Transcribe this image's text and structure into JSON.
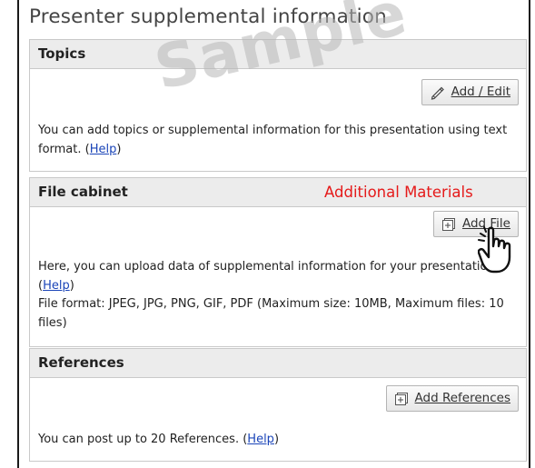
{
  "page": {
    "title": "Presenter supplemental information",
    "watermark": "Sample"
  },
  "topics": {
    "header": "Topics",
    "button_label": "Add / Edit",
    "button_icon": "pencil-icon",
    "desc_text": "You can add topics or supplemental information for this presentation using text format. (",
    "help_link": "Help",
    "desc_tail": ")"
  },
  "file_cabinet": {
    "header": "File cabinet",
    "annotation": "Additional Materials",
    "annotation_color": "#e51a1a",
    "button_label": "Add File",
    "button_icon": "add-box-icon",
    "desc_text": "Here, you can upload data of supplemental information for your presentation.",
    "help_link": "Help",
    "format_text": "File format: JPEG, JPG, PNG, GIF, PDF (Maximum size: 10MB, Maximum files: 10 files)",
    "cursor_icon": "hand-pointer-icon"
  },
  "references": {
    "header": "References",
    "button_label": "Add References",
    "button_icon": "add-box-icon",
    "desc_text": "You can post up to 20 References. (",
    "help_link": "Help",
    "desc_tail": ")"
  },
  "colors": {
    "header_bg": "#ececec",
    "link": "#1a44b8",
    "border": "#c9c9c9"
  }
}
